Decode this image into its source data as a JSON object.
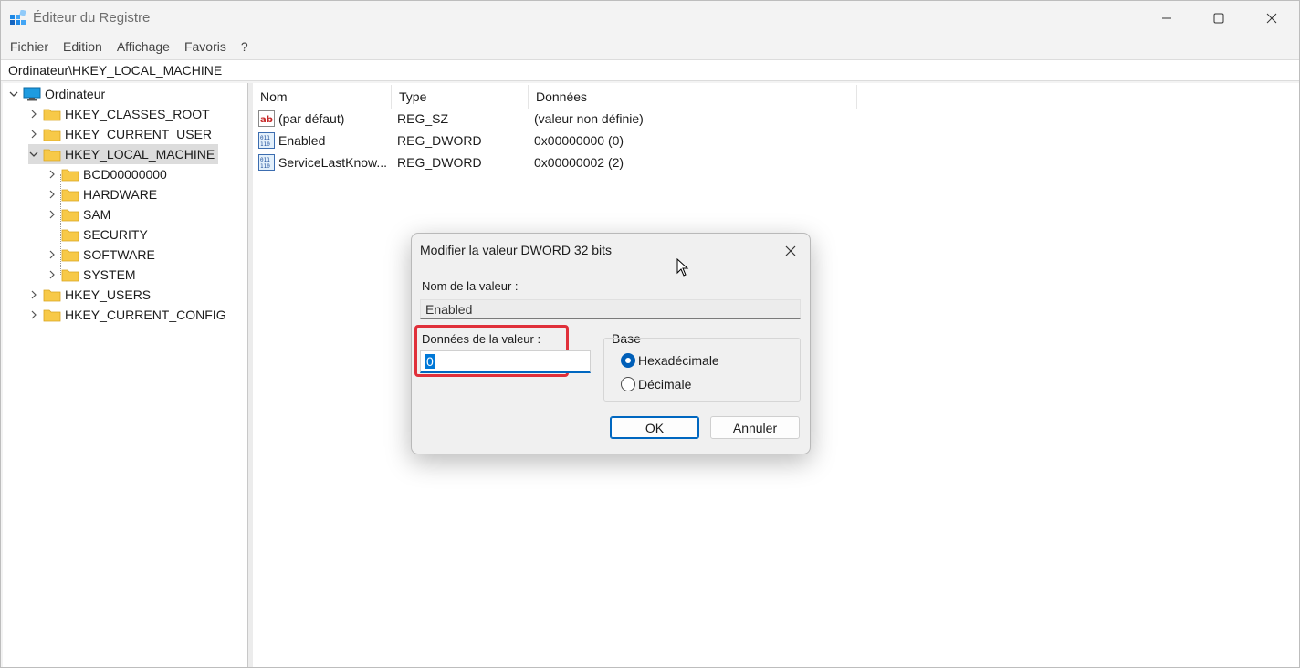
{
  "window": {
    "title": "Éditeur du Registre",
    "icons": {
      "app": "registry-editor-icon",
      "minimize": "minimize-icon",
      "maximize": "maximize-icon",
      "close": "close-icon"
    }
  },
  "menu": [
    "Fichier",
    "Edition",
    "Affichage",
    "Favoris",
    "?"
  ],
  "address": "Ordinateur\\HKEY_LOCAL_MACHINE",
  "tree": {
    "root": "Ordinateur",
    "hives": [
      "HKEY_CLASSES_ROOT",
      "HKEY_CURRENT_USER",
      "HKEY_LOCAL_MACHINE",
      "HKEY_USERS",
      "HKEY_CURRENT_CONFIG"
    ],
    "hklm_children": [
      "BCD00000000",
      "HARDWARE",
      "SAM",
      "SECURITY",
      "SOFTWARE",
      "SYSTEM"
    ],
    "selected": "HKEY_LOCAL_MACHINE"
  },
  "list": {
    "columns": [
      "Nom",
      "Type",
      "Données"
    ],
    "rows": [
      {
        "name": "(par défaut)",
        "type": "REG_SZ",
        "data": "(valeur non définie)",
        "icon": "string-value-icon"
      },
      {
        "name": "Enabled",
        "type": "REG_DWORD",
        "data": "0x00000000 (0)",
        "icon": "binary-value-icon"
      },
      {
        "name": "ServiceLastKnow...",
        "type": "REG_DWORD",
        "data": "0x00000002 (2)",
        "icon": "binary-value-icon"
      }
    ]
  },
  "dialog": {
    "title": "Modifier la valeur DWORD 32 bits",
    "value_name_label": "Nom de la valeur :",
    "value_name": "Enabled",
    "value_data_label": "Données de la valeur :",
    "value_data": "0",
    "base_label": "Base",
    "base_options": [
      "Hexadécimale",
      "Décimale"
    ],
    "base_selected": "Hexadécimale",
    "ok": "OK",
    "cancel": "Annuler",
    "highlight_color": "#e0303a"
  },
  "colors": {
    "accent": "#0067c0",
    "selection": "#dcdcdc"
  }
}
